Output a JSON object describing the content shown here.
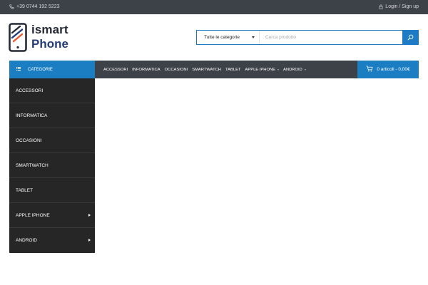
{
  "topbar": {
    "phone": "+39 0744 192 5223",
    "phone_icon": "phone-icon",
    "login": "Login / Sign up",
    "login_icon": "lock-icon"
  },
  "logo": {
    "line1": "ismart",
    "line2": "Phone",
    "icon": "phone-logo-icon"
  },
  "search": {
    "category": "Tutte le categorie",
    "placeholder": "Cerca prodotto",
    "button_icon": "search-icon"
  },
  "categories_button": {
    "label": "CATEGORIE",
    "icon": "list-icon"
  },
  "main_menu": [
    {
      "label": "ACCESSORI",
      "has_submenu": false
    },
    {
      "label": "INFORMATICA",
      "has_submenu": false
    },
    {
      "label": "OCCASIONI",
      "has_submenu": false
    },
    {
      "label": "SMARTWATCH",
      "has_submenu": false
    },
    {
      "label": "TABLET",
      "has_submenu": false
    },
    {
      "label": "APPLE IPHONE",
      "has_submenu": true
    },
    {
      "label": "ANDROID",
      "has_submenu": true
    }
  ],
  "cart": {
    "label": "0 articoli - 0,00€",
    "icon": "cart-icon"
  },
  "sidebar_items": [
    {
      "label": "ACCESSORI",
      "has_submenu": false
    },
    {
      "label": "INFORMATICA",
      "has_submenu": false
    },
    {
      "label": "OCCASIONI",
      "has_submenu": false
    },
    {
      "label": "SMARTWATCH",
      "has_submenu": false
    },
    {
      "label": "TABLET",
      "has_submenu": false
    },
    {
      "label": "APPLE IPHONE",
      "has_submenu": true
    },
    {
      "label": "ANDROID",
      "has_submenu": true
    }
  ],
  "colors": {
    "topbar": "#3d4148",
    "accent": "#1b7ec3",
    "sidebar": "#262626",
    "logo_dark": "#242a36",
    "logo_blue": "#233d7a",
    "logo_orange": "#f0582f"
  }
}
